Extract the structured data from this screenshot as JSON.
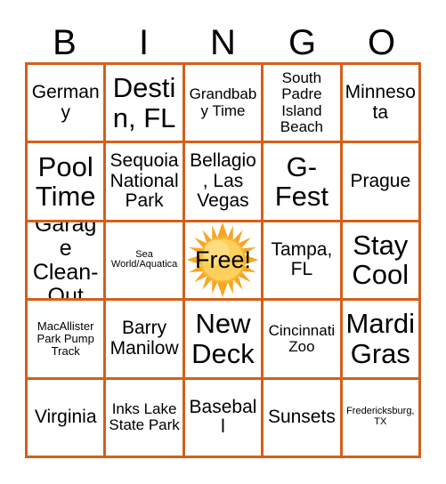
{
  "card": {
    "header_letters": [
      "B",
      "I",
      "N",
      "G",
      "O"
    ],
    "border_color": "#d2601a",
    "background_color": "#ffffff",
    "text_color": "#000000",
    "columns": 5,
    "rows": 5
  },
  "free_space": {
    "label": "Free!",
    "icon": "sun-icon",
    "sun_outer_color": "#f5a623",
    "sun_inner_color": "#fdd05c",
    "row": 3,
    "column": 3
  },
  "grid": [
    [
      {
        "text": "Germany",
        "size": "md"
      },
      {
        "text": "Destin, FL",
        "size": "xl"
      },
      {
        "text": "Grandbaby Time",
        "size": "sm"
      },
      {
        "text": "South Padre Island Beach",
        "size": "sm"
      },
      {
        "text": "Minnesota",
        "size": "md"
      }
    ],
    [
      {
        "text": "Pool Time",
        "size": "xl"
      },
      {
        "text": "Sequoia National Park",
        "size": "md"
      },
      {
        "text": "Bellagio, Las Vegas",
        "size": "md"
      },
      {
        "text": "G-Fest",
        "size": "xl"
      },
      {
        "text": "Prague",
        "size": "md"
      }
    ],
    [
      {
        "text": "Garage Clean-Out",
        "size": "lg"
      },
      {
        "text": "Sea World/Aquatica",
        "size": "xxs"
      },
      {
        "text": "Free!",
        "size": "free"
      },
      {
        "text": "Tampa, FL",
        "size": "md"
      },
      {
        "text": "Stay Cool",
        "size": "xl"
      }
    ],
    [
      {
        "text": "MacAllister Park Pump Track",
        "size": "xs"
      },
      {
        "text": "Barry Manilow",
        "size": "md"
      },
      {
        "text": "New Deck",
        "size": "xl"
      },
      {
        "text": "Cincinnati Zoo",
        "size": "sm"
      },
      {
        "text": "Mardi Gras",
        "size": "xl"
      }
    ],
    [
      {
        "text": "Virginia",
        "size": "md"
      },
      {
        "text": "Inks Lake State Park",
        "size": "sm"
      },
      {
        "text": "Baseball",
        "size": "md"
      },
      {
        "text": "Sunsets",
        "size": "md"
      },
      {
        "text": "Fredericksburg, TX",
        "size": "xxs"
      }
    ]
  ]
}
